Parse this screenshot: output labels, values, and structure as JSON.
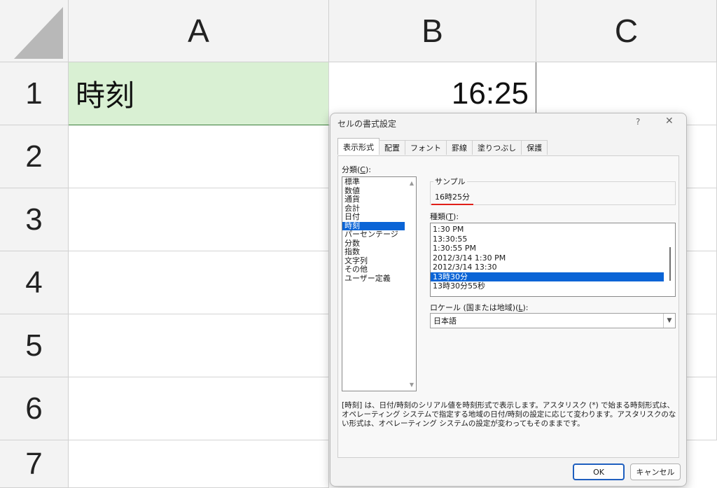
{
  "sheet": {
    "columns": [
      "A",
      "B",
      "C"
    ],
    "rows": [
      "1",
      "2",
      "3",
      "4",
      "5",
      "6",
      "7"
    ],
    "a1": "時刻",
    "b1": "16:25"
  },
  "dialog": {
    "title": "セルの書式設定",
    "help": "?",
    "close": "✕",
    "tabs": [
      "表示形式",
      "配置",
      "フォント",
      "罫線",
      "塗りつぶし",
      "保護"
    ],
    "category_label": "分類(",
    "category_key": "C",
    "category_label_end": "):",
    "categories": [
      "標準",
      "数値",
      "通貨",
      "会計",
      "日付",
      "時刻",
      "パーセンテージ",
      "分数",
      "指数",
      "文字列",
      "その他",
      "ユーザー定義"
    ],
    "selected_category": "時刻",
    "sample_label": "サンプル",
    "sample_value": "16時25分",
    "type_label": "種類(",
    "type_key": "T",
    "type_label_end": "):",
    "types": [
      "1:30 PM",
      "13:30:55",
      "1:30:55 PM",
      "2012/3/14 1:30 PM",
      "2012/3/14 13:30",
      "13時30分",
      "13時30分55秒"
    ],
    "selected_type": "13時30分",
    "locale_label": "ロケール (国または地域)(",
    "locale_key": "L",
    "locale_label_end": "):",
    "locale_value": "日本語",
    "description": "[時刻] は、日付/時刻のシリアル値を時刻形式で表示します。アスタリスク (*) で始まる時刻形式は、オペレーティング システムで指定する地域の日付/時刻の設定に応じて変わります。アスタリスクのない形式は、オペレーティング システムの設定が変わってもそのままです。",
    "ok": "OK",
    "cancel": "キャンセル"
  }
}
